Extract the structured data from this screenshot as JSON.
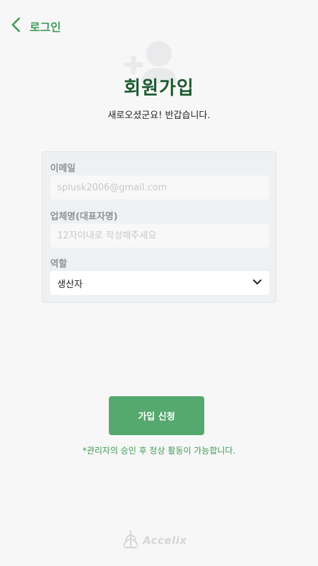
{
  "header": {
    "back_label": "로그인"
  },
  "page": {
    "title": "회원가입",
    "subtitle": "새로오셨군요! 반갑습니다.",
    "hero_icon": "add-user-icon"
  },
  "form": {
    "email": {
      "label": "이메일",
      "value": "",
      "placeholder": "splusk2006@gmail.com"
    },
    "company": {
      "label": "업체명(대표자명)",
      "value": "",
      "placeholder": "12자이내로 작성해주세요"
    },
    "role": {
      "label": "역할",
      "selected": "생산자"
    }
  },
  "actions": {
    "submit_label": "가입 신청"
  },
  "notice": "*관리자의 승인 후 정상 활동이 가능합니다.",
  "brand": {
    "name": "Accelix"
  },
  "colors": {
    "accent": "#3f9a58",
    "button": "#55a86e",
    "title": "#1f5a30",
    "background": "#f7f7f7"
  }
}
